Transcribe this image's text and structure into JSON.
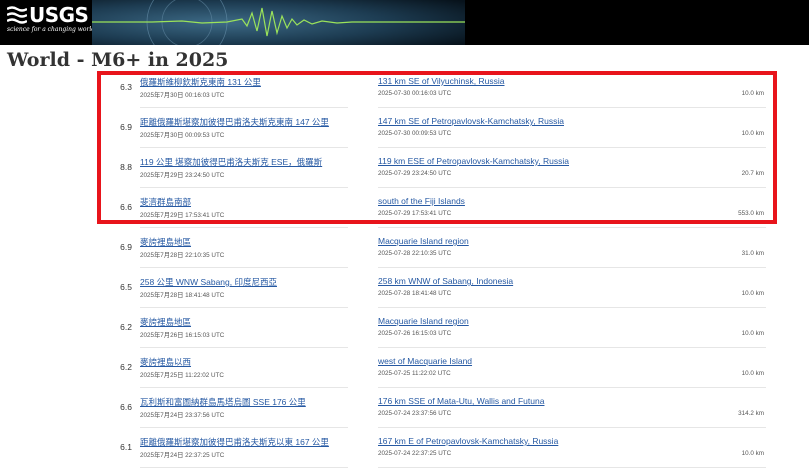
{
  "header": {
    "logo_text": "USGS",
    "logo_tagline": "science for a changing world",
    "logo_icon": "usgs-wave-icon",
    "banner_icon": "seismogram-icon"
  },
  "page": {
    "title": "World - M6+ in 2025"
  },
  "events": [
    {
      "mag": "6.3",
      "place_zh": "俄羅斯維柳欽斯克東南 131 公里",
      "time_zh": "2025年7月30日 00:16:03 UTC",
      "place_en": "131 km SE of Vilyuchinsk, Russia",
      "time_en": "2025-07-30 00:16:03 UTC",
      "depth": "10.0 km"
    },
    {
      "mag": "6.9",
      "place_zh": "距離俄羅斯堪察加彼得巴甫洛夫斯克東南 147 公里",
      "time_zh": "2025年7月30日 00:09:53 UTC",
      "place_en": "147 km SE of Petropavlovsk-Kamchatsky, Russia",
      "time_en": "2025-07-30 00:09:53 UTC",
      "depth": "10.0 km"
    },
    {
      "mag": "8.8",
      "place_zh": "119 公里 堪察加彼得巴甫洛夫斯克 ESE，俄羅斯",
      "time_zh": "2025年7月29日 23:24:50 UTC",
      "place_en": "119 km ESE of Petropavlovsk-Kamchatsky, Russia",
      "time_en": "2025-07-29 23:24:50 UTC",
      "depth": "20.7 km"
    },
    {
      "mag": "6.6",
      "place_zh": "斐濟群島南部",
      "time_zh": "2025年7月29日 17:53:41 UTC",
      "place_en": "south of the Fiji Islands",
      "time_en": "2025-07-29 17:53:41 UTC",
      "depth": "553.0 km"
    },
    {
      "mag": "6.9",
      "place_zh": "麥誇裡島地區",
      "time_zh": "2025年7月28日 22:10:35 UTC",
      "place_en": "Macquarie Island region",
      "time_en": "2025-07-28 22:10:35 UTC",
      "depth": "31.0 km"
    },
    {
      "mag": "6.5",
      "place_zh": "258 公里 WNW Sabang, 印度尼西亞",
      "time_zh": "2025年7月28日 18:41:48 UTC",
      "place_en": "258 km WNW of Sabang, Indonesia",
      "time_en": "2025-07-28 18:41:48 UTC",
      "depth": "10.0 km"
    },
    {
      "mag": "6.2",
      "place_zh": "麥誇裡島地區",
      "time_zh": "2025年7月26日 16:15:03 UTC",
      "place_en": "Macquarie Island region",
      "time_en": "2025-07-26 16:15:03 UTC",
      "depth": "10.0 km"
    },
    {
      "mag": "6.2",
      "place_zh": "麥誇裡島以西",
      "time_zh": "2025年7月25日 11:22:02 UTC",
      "place_en": "west of Macquarie Island",
      "time_en": "2025-07-25 11:22:02 UTC",
      "depth": "10.0 km"
    },
    {
      "mag": "6.6",
      "place_zh": "瓦利斯和富圖納群島馬塔烏圖 SSE 176 公里",
      "time_zh": "2025年7月24日 23:37:56 UTC",
      "place_en": "176 km SSE of Mata-Utu, Wallis and Futuna",
      "time_en": "2025-07-24 23:37:56 UTC",
      "depth": "314.2 km"
    },
    {
      "mag": "6.1",
      "place_zh": "距離俄羅斯堪察加彼得巴甫洛夫斯克以東 167 公里",
      "time_zh": "2025年7月24日 22:37:25 UTC",
      "place_en": "167 km E of Petropavlovsk-Kamchatsky, Russia",
      "time_en": "2025-07-24 22:37:25 UTC",
      "depth": "10.0 km"
    }
  ],
  "colors": {
    "link": "#2659a3",
    "highlight_border": "#e8141b",
    "header_bg": "#000000"
  }
}
